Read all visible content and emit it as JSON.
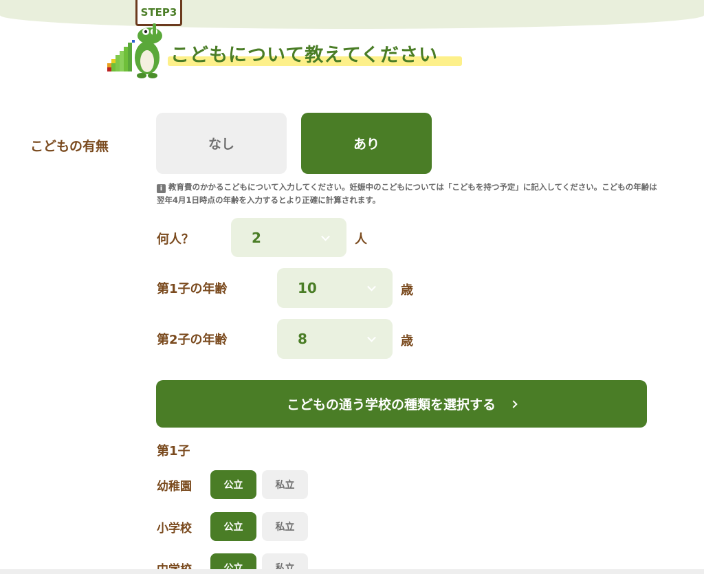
{
  "header": {
    "step_label": "STEP3",
    "title": "こどもについて教えてください"
  },
  "children_presence": {
    "label": "こどもの有無",
    "options": [
      "なし",
      "あり"
    ],
    "selected": "あり"
  },
  "note": "教育費のかかるこどもについて入力してください。妊娠中のこどもについては「こどもを持つ予定」に記入してください。こどもの年齢は翌年4月1日時点の年齢を入力するとより正確に計算されます。",
  "count": {
    "label": "何人？",
    "value": "2",
    "unit": "人"
  },
  "ages": [
    {
      "label": "第1子の年齢",
      "value": "10",
      "unit": "歳"
    },
    {
      "label": "第2子の年齢",
      "value": "8",
      "unit": "歳"
    }
  ],
  "school_button": "こどもの通う学校の種類を選択する",
  "child1": {
    "label": "第1子",
    "rows": [
      {
        "label": "幼稚園",
        "public": "公立",
        "private": "私立",
        "selected": "公立"
      },
      {
        "label": "小学校",
        "public": "公立",
        "private": "私立",
        "selected": "公立"
      },
      {
        "label": "中学校",
        "public": "公立",
        "private": "私立",
        "selected": "公立"
      }
    ]
  },
  "colors": {
    "accent": "#4a7d26",
    "label_brown": "#7a4a1e",
    "select_bg": "#eaf1e0",
    "highlight": "#fdf08a"
  }
}
